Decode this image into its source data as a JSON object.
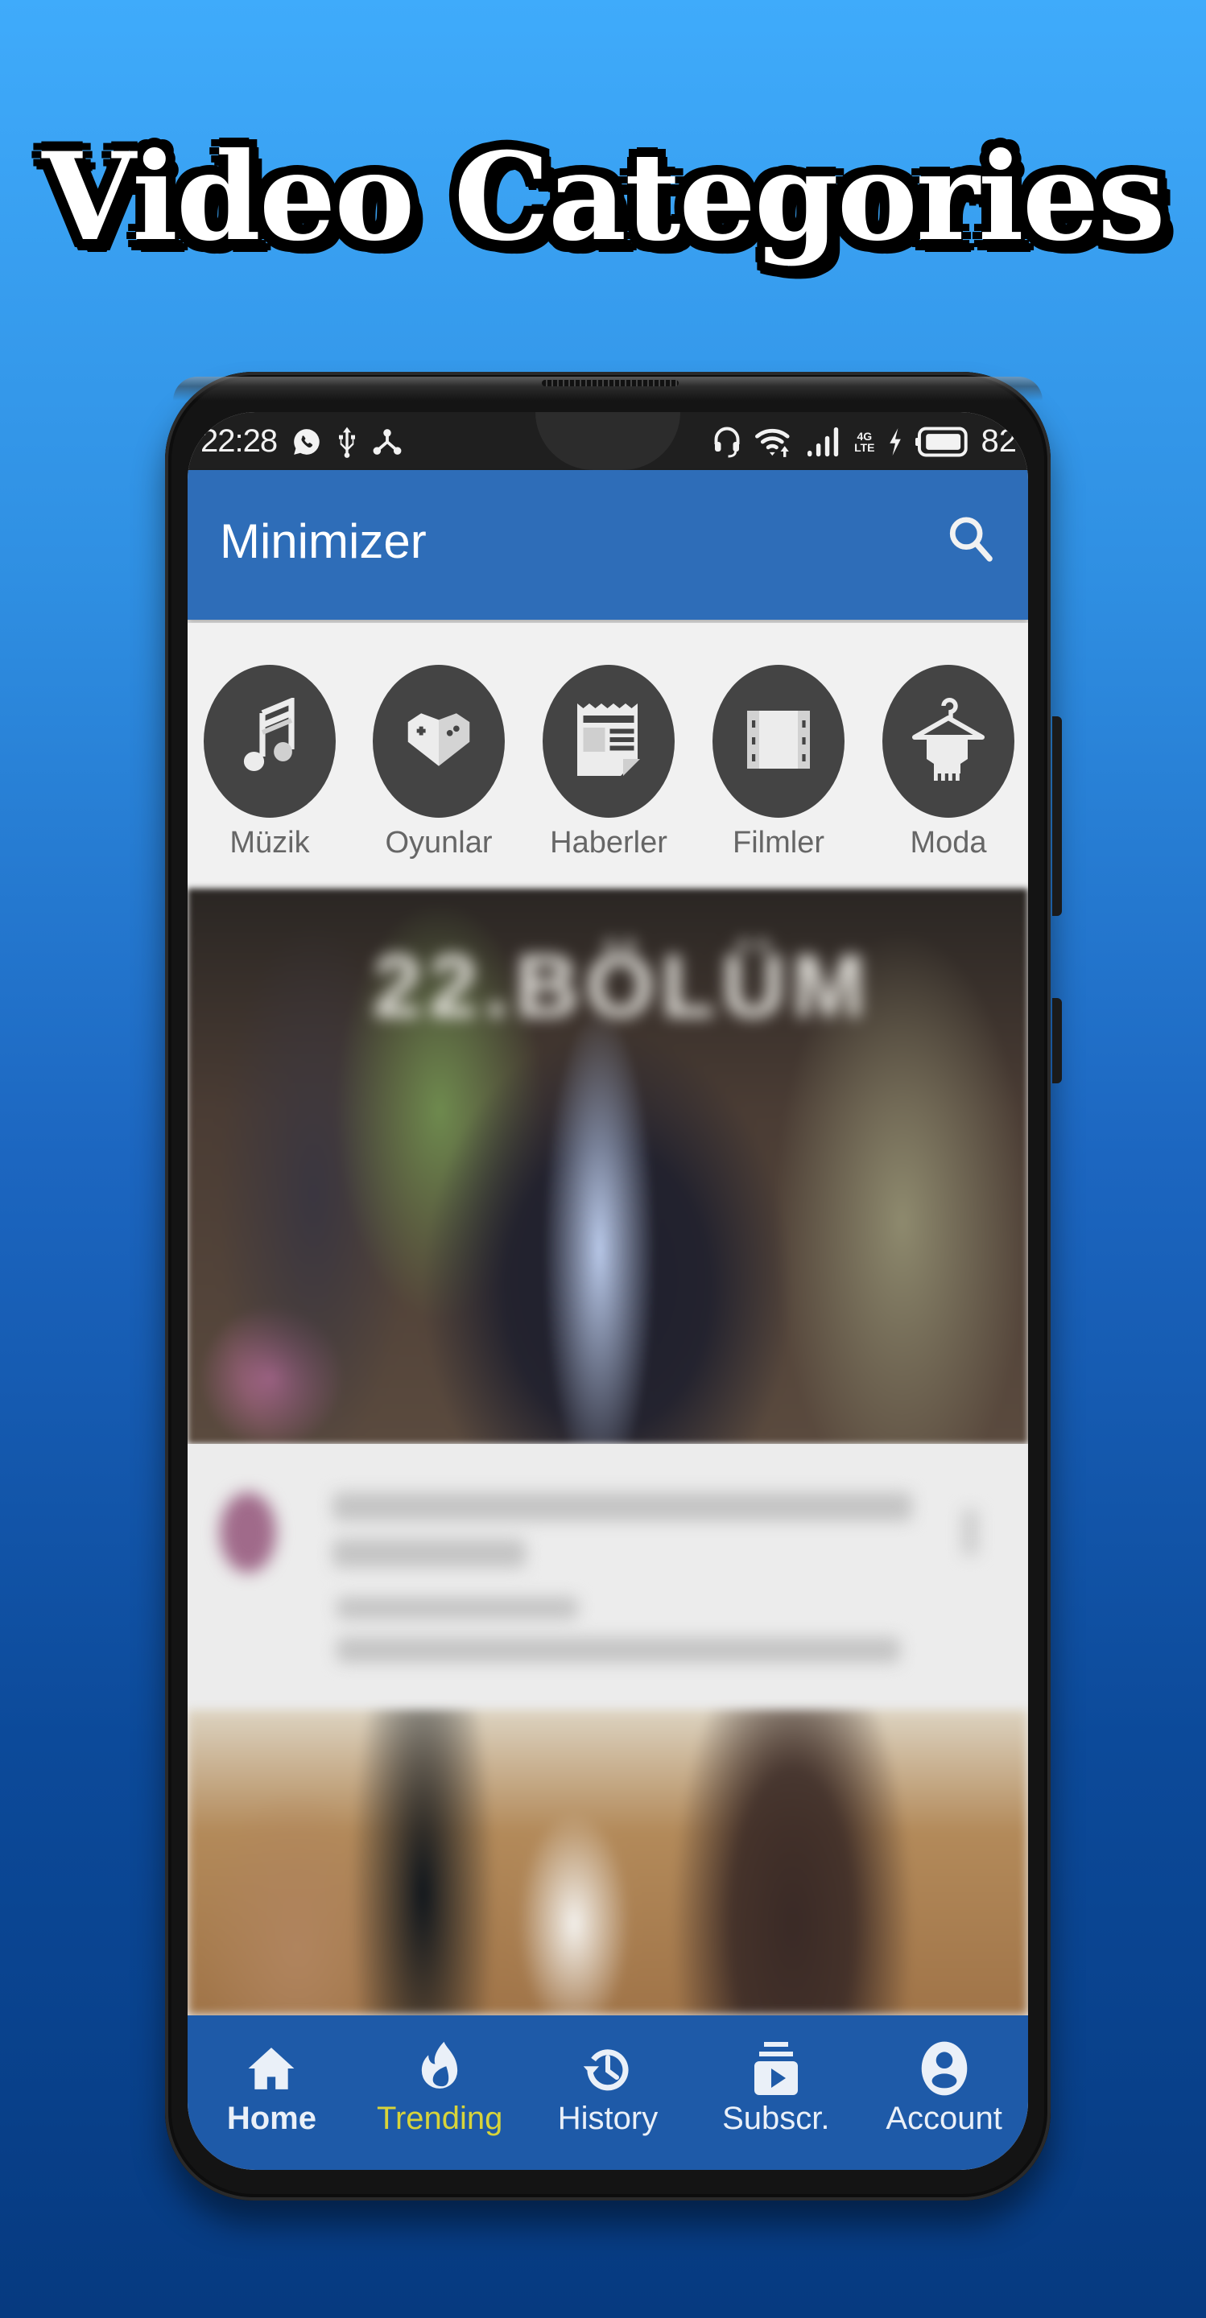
{
  "headline": "Video Categories",
  "status_bar": {
    "time": "22:28",
    "left_icons": [
      "whatsapp-icon",
      "usb-icon",
      "share-icon"
    ],
    "right_icons": [
      "headset-icon",
      "wifi-icon",
      "signal-icon",
      "lte-icon",
      "charging-icon",
      "battery-icon"
    ],
    "network_top": "4G",
    "network_bottom": "LTE",
    "battery_percent": "82"
  },
  "app_bar": {
    "title": "Minimizer",
    "search_icon": "search-icon"
  },
  "categories": [
    {
      "label": "Müzik",
      "icon": "music-note-icon"
    },
    {
      "label": "Oyunlar",
      "icon": "gamepad-heart-icon"
    },
    {
      "label": "Haberler",
      "icon": "newspaper-icon"
    },
    {
      "label": "Filmler",
      "icon": "film-icon"
    },
    {
      "label": "Moda",
      "icon": "hanger-icon"
    }
  ],
  "videos": [
    {
      "thumbnail_overlay": "22.BÖLÜM",
      "blurred": true
    },
    {
      "blurred": true
    }
  ],
  "colors": {
    "app_bar": "#2e6db8",
    "bottom_nav": "#1e5aa8",
    "active_tab": "#d8d43a",
    "category_circle": "#444444"
  },
  "bottom_nav": {
    "items": [
      {
        "label": "Home",
        "icon": "home-icon"
      },
      {
        "label": "Trending",
        "icon": "flame-icon",
        "active": true
      },
      {
        "label": "History",
        "icon": "history-icon"
      },
      {
        "label": "Subscr.",
        "icon": "subscriptions-icon"
      },
      {
        "label": "Account",
        "icon": "account-icon"
      }
    ]
  }
}
